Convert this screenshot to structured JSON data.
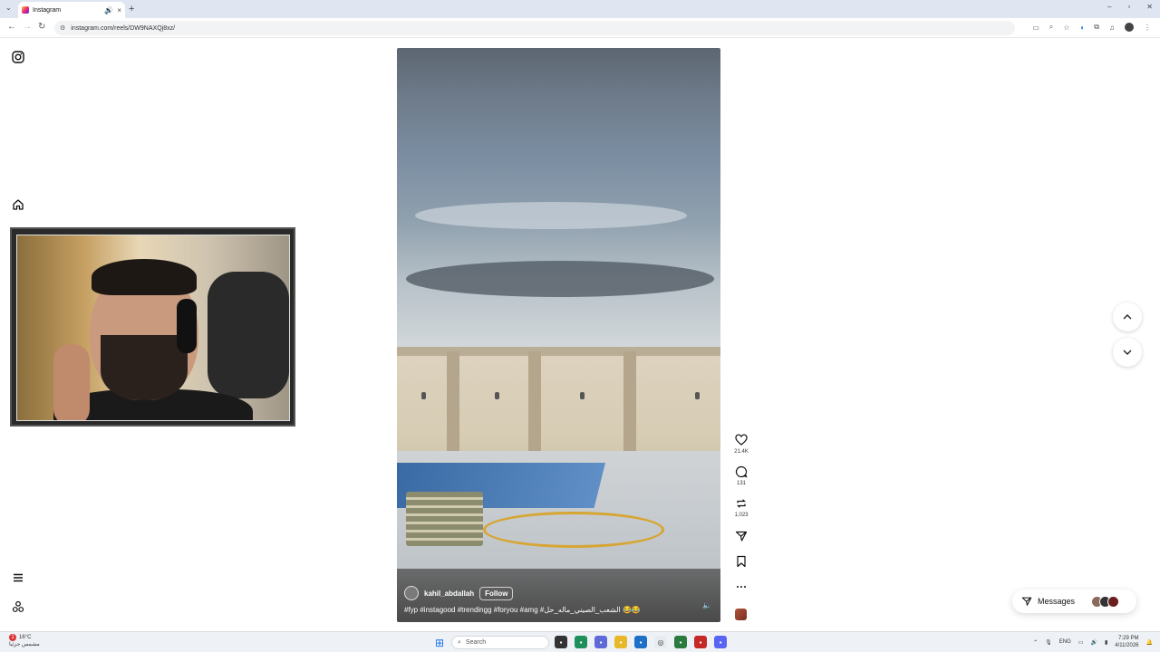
{
  "browser": {
    "tab_title": "Instagram",
    "url": "instagram.com/reels/DW9NAXQj8xz/",
    "new_tab": "+",
    "tab_close": "×",
    "tab_audio": "🔊",
    "tab_menu": "⌄",
    "win_min": "–",
    "win_max": "▫",
    "win_close": "✕",
    "back": "←",
    "forward": "→",
    "reload": "↻"
  },
  "rail": {
    "logo_icon": "instagram-icon",
    "home_icon": "home-icon",
    "menu_icon": "hamburger-icon",
    "also_from_meta_icon": "apps-icon"
  },
  "reel": {
    "author": "kahil_abdallah",
    "follow_label": "Follow",
    "caption": "#fyp #instagood #trendingg #foryou #amg #الشعب_الصيني_ماله_حل 😂😂",
    "mute_icon": "🔈"
  },
  "actions": {
    "like_count": "21.4K",
    "comment_count": "131",
    "repost_count": "1,023"
  },
  "messages": {
    "label": "Messages"
  },
  "taskbar": {
    "temp": "16°C",
    "weather_text": "مشمس جزئيا",
    "alert_badge": "1",
    "search_placeholder": "Search",
    "lang": "ENG",
    "time": "7:29 PM",
    "date": "4/11/2026"
  },
  "colors": {
    "accent_blue": "#1a73e8",
    "instagram_gradient_start": "#f9ce34",
    "instagram_gradient_end": "#6228d7"
  }
}
